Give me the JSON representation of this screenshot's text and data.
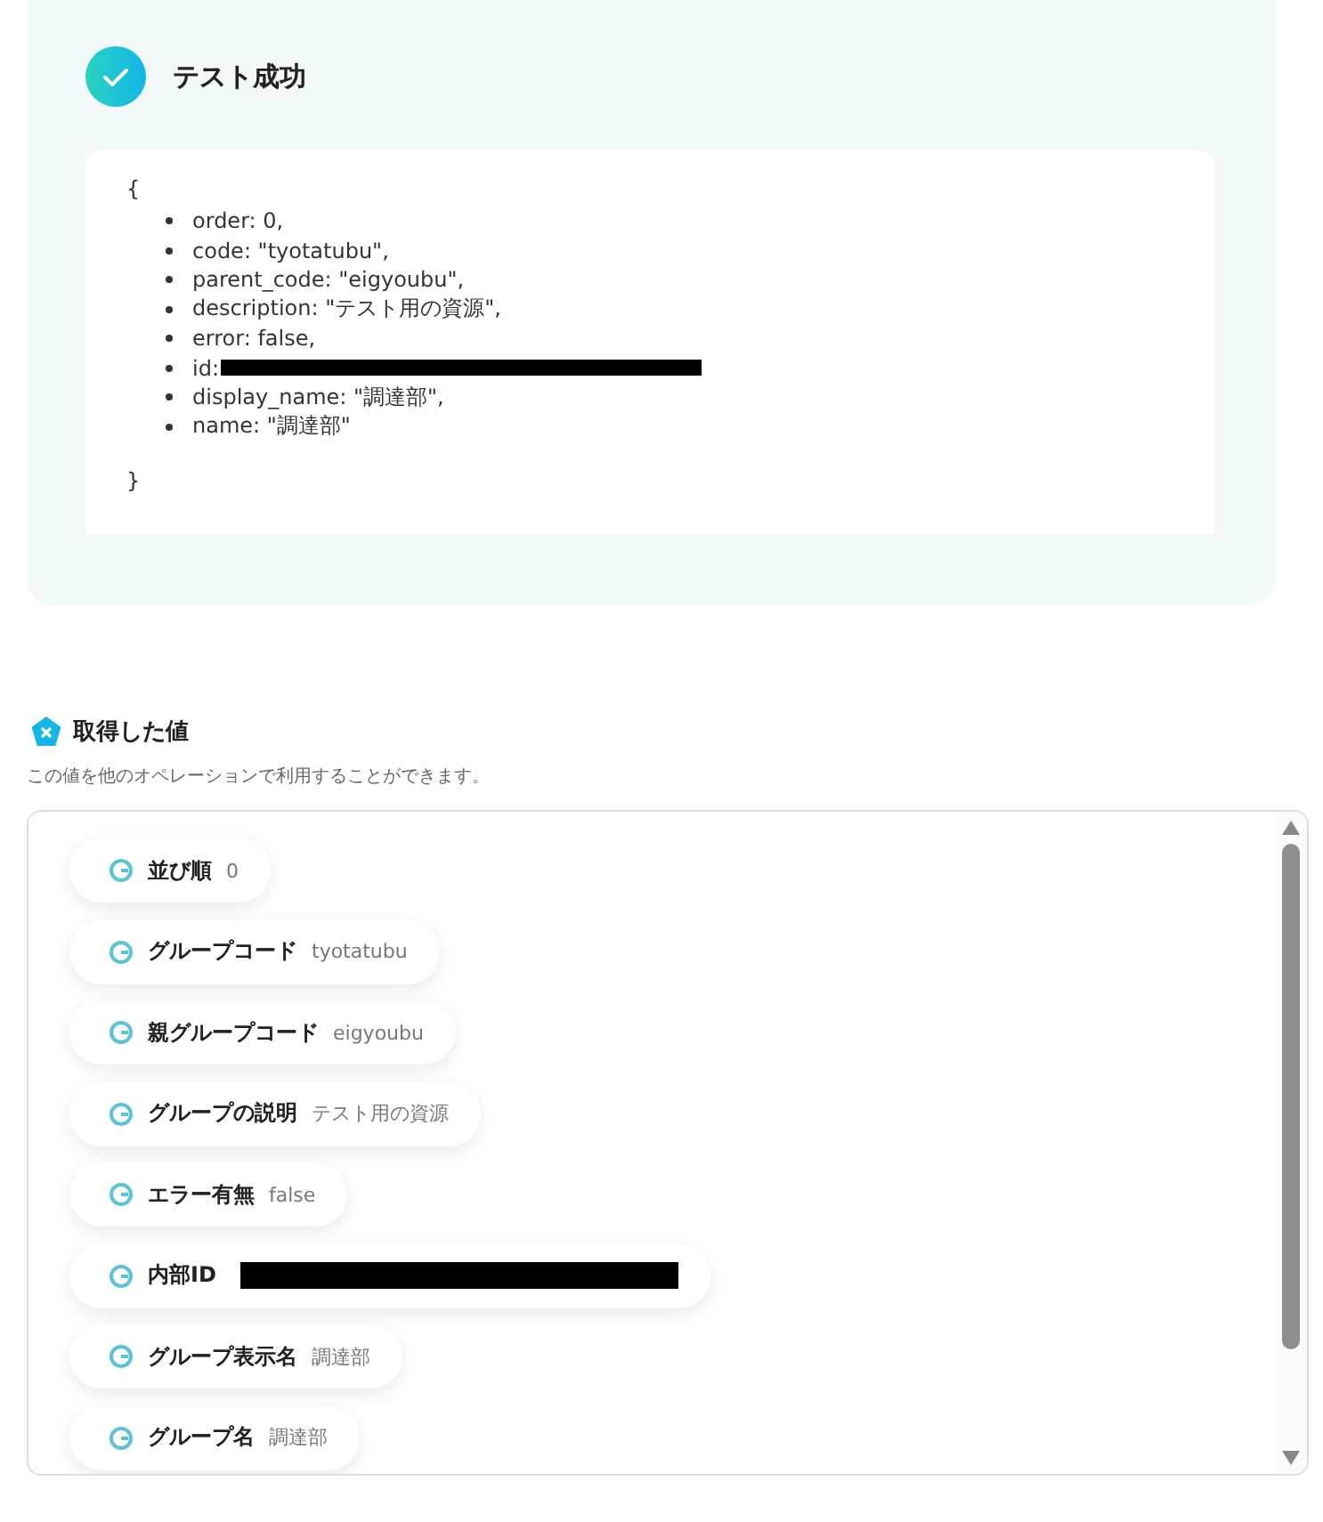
{
  "result": {
    "title": "テスト成功",
    "open_brace": "{",
    "close_brace": "}",
    "lines": [
      {
        "text": "order: 0,",
        "redacted": false
      },
      {
        "text": "code: \"tyotatubu\",",
        "redacted": false
      },
      {
        "text": "parent_code: \"eigyoubu\",",
        "redacted": false
      },
      {
        "text": "description: \"テスト用の資源\",",
        "redacted": false
      },
      {
        "text": "error: false,",
        "redacted": false
      },
      {
        "text": "id:",
        "redacted": true
      },
      {
        "text": "display_name: \"調達部\",",
        "redacted": false
      },
      {
        "text": "name: \"調達部\"",
        "redacted": false
      }
    ]
  },
  "values": {
    "title": "取得した値",
    "description": "この値を他のオペレーションで利用することができます。",
    "items": [
      {
        "label": "並び順",
        "value": "0",
        "redacted": false
      },
      {
        "label": "グループコード",
        "value": "tyotatubu",
        "redacted": false
      },
      {
        "label": "親グループコード",
        "value": "eigyoubu",
        "redacted": false
      },
      {
        "label": "グループの説明",
        "value": "テスト用の資源",
        "redacted": false
      },
      {
        "label": "エラー有無",
        "value": "false",
        "redacted": false
      },
      {
        "label": "内部ID",
        "redacted": true
      },
      {
        "label": "グループ表示名",
        "value": "調達部",
        "redacted": false
      },
      {
        "label": "グループ名",
        "value": "調達部",
        "redacted": false
      }
    ]
  }
}
